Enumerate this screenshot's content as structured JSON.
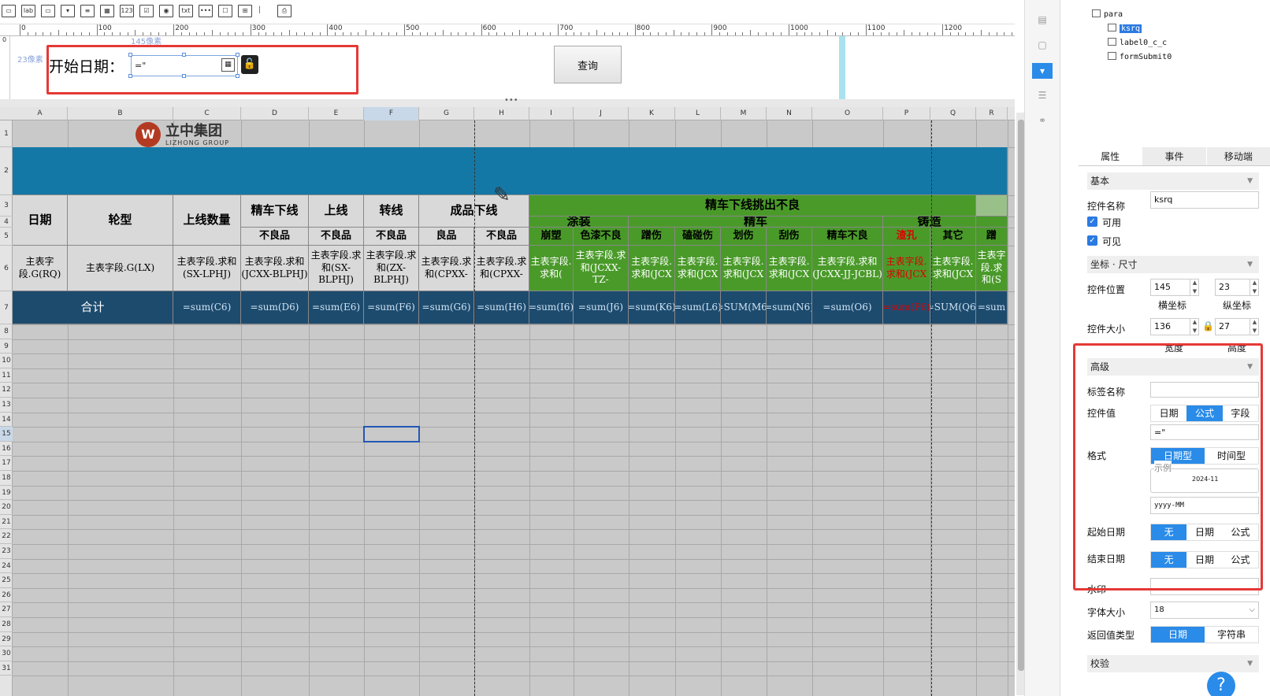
{
  "toolbar": {
    "items": [
      "input",
      "label",
      "button",
      "select",
      "textarea",
      "date",
      "number",
      "checkbox",
      "radio",
      "file",
      "password",
      "tree",
      "table",
      "print",
      "more"
    ]
  },
  "ruler": {
    "ticks": [
      "0",
      "100",
      "200",
      "300",
      "400",
      "500",
      "600",
      "700",
      "800",
      "900",
      "1000",
      "1100",
      "1200"
    ]
  },
  "canvas": {
    "x_hint": "145像素",
    "y_hint": "23像素",
    "start_label": "开始日期：",
    "date_value": "=\"",
    "query_button": "查询",
    "dots": "•••"
  },
  "columns": [
    "A",
    "B",
    "C",
    "D",
    "E",
    "F",
    "G",
    "H",
    "I",
    "J",
    "K",
    "L",
    "M",
    "N",
    "O",
    "P",
    "Q",
    "R"
  ],
  "rows": [
    "1",
    "2",
    "3",
    "4",
    "5",
    "6",
    "7",
    "8",
    "9",
    "10",
    "11",
    "12",
    "13",
    "14",
    "15",
    "16",
    "17",
    "18",
    "19",
    "20",
    "21",
    "22",
    "23",
    "24",
    "25",
    "26",
    "27",
    "28",
    "29",
    "30",
    "31"
  ],
  "logo": {
    "cn": "立中集团",
    "en": "LIZHONG GROUP"
  },
  "report": {
    "h_date": "日期",
    "h_type": "轮型",
    "h_online_qty": "上线数量",
    "h_finish": "精车下线",
    "h_online": "上线",
    "h_transfer": "转线",
    "h_product": "成品下线",
    "h_defect_main": "精车下线挑出不良",
    "h_coating": "涂装",
    "h_machining": "精车",
    "h_casting": "铸造",
    "sub_bad1": "不良品",
    "sub_bad2": "不良品",
    "sub_bad3": "不良品",
    "sub_good": "良品",
    "sub_bad4": "不良品",
    "sub_I": "崩塑",
    "sub_J": "色漆不良",
    "sub_K": "蹭伤",
    "sub_L": "磕碰伤",
    "sub_M": "划伤",
    "sub_N": "刮伤",
    "sub_O": "精车不良",
    "sub_P": "渣孔",
    "sub_Q": "其它",
    "sub_R": "蹭",
    "r6": {
      "A": "主表字段.G(RQ)",
      "B": "主表字段.G(LX)",
      "C": "主表字段.求和(SX-LPHJ)",
      "D": "主表字段.求和(JCXX-BLPHJ)",
      "E": "主表字段.求和(SX-BLPHJ)",
      "F": "主表字段.求和(ZX-BLPHJ)",
      "G": "主表字段.求和(CPXX-",
      "H": "主表字段.求和(CPXX-",
      "I": "主表字段.求和(",
      "J": "主表字段.求和(JCXX-TZ-",
      "K": "主表字段.求和(JCX",
      "L": "主表字段.求和(JCX",
      "M": "主表字段.求和(JCX",
      "N": "主表字段.求和(JCX",
      "O": "主表字段.求和(JCXX-JJ-JCBL)",
      "P": "主表字段.求和(JCX",
      "Q": "主表字段.求和(JCX",
      "R": "主表字段.求和(S"
    },
    "r7": {
      "A": "合计",
      "C": "=sum(C6)",
      "D": "=sum(D6)",
      "E": "=sum(E6)",
      "F": "=sum(F6)",
      "G": "=sum(G6)",
      "H": "=sum(H6)",
      "I": "=sum(I6)",
      "J": "=sum(J6)",
      "K": "=sum(K6)",
      "L": "=sum(L6)",
      "M": "=SUM(M6)",
      "N": "=sum(N6)",
      "O": "=sum(O6)",
      "P": "=sum(P6)",
      "Q": "=SUM(Q6)",
      "R": "=sum"
    }
  },
  "tree": {
    "root": "para",
    "items": [
      "ksrq",
      "label0_c_c",
      "formSubmit0"
    ]
  },
  "panel": {
    "tabs": [
      "属性",
      "事件",
      "移动端"
    ],
    "sec_basic": "基本",
    "name_label": "控件名称",
    "name_value": "ksrq",
    "enabled": "可用",
    "visible": "可见",
    "sec_coord": "坐标 · 尺寸",
    "pos_label": "控件位置",
    "pos_x": "145",
    "pos_y": "23",
    "x_caption": "横坐标",
    "y_caption": "纵坐标",
    "size_label": "控件大小",
    "width": "136",
    "height": "27",
    "w_caption": "宽度",
    "h_caption": "高度",
    "sec_adv": "高级",
    "tag_label": "标签名称",
    "value_label": "控件值",
    "value_opts": [
      "日期",
      "公式",
      "字段"
    ],
    "value_input": "=\"",
    "format_label": "格式",
    "format_opts": [
      "日期型",
      "时间型"
    ],
    "example_legend": "示例",
    "example_value": "2024-11",
    "format_input": "yyyy-MM",
    "start_label": "起始日期",
    "start_opts": [
      "无",
      "日期",
      "公式"
    ],
    "end_label": "结束日期",
    "end_opts": [
      "无",
      "日期",
      "公式"
    ],
    "watermark_label": "水印",
    "font_label": "字体大小",
    "font_value": "18",
    "return_label": "返回值类型",
    "return_opts": [
      "日期",
      "字符串"
    ],
    "verify_label": "校验"
  },
  "colors": {
    "accent": "#2a8be8",
    "highlight": "#e53935",
    "header_green": "#4a9a2a",
    "dark_row": "#1d4b6e",
    "banner": "#1478a6"
  }
}
